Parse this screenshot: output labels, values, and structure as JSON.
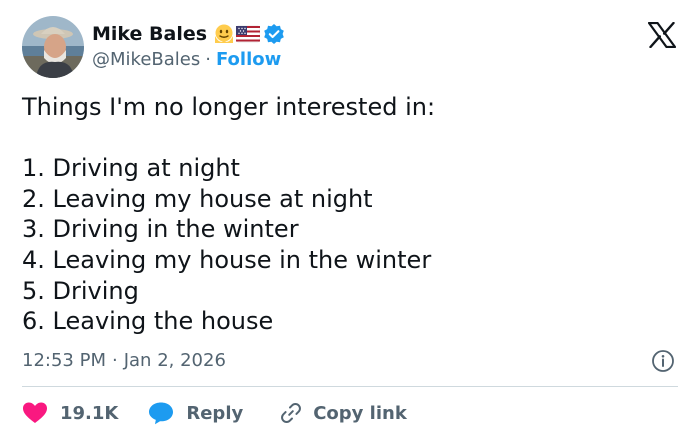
{
  "author": {
    "display_name": "Mike Bales",
    "handle": "@MikeBales",
    "separator": "·",
    "follow_label": "Follow",
    "badges": [
      "melting-face-emoji",
      "us-flag-emoji",
      "verified-badge"
    ]
  },
  "tweet": {
    "intro": "Things I'm no longer interested in:",
    "items": [
      "1. Driving at night",
      "2. Leaving my house at night",
      "3. Driving in the winter",
      "4. Leaving my house in the winter",
      "5. Driving",
      "6. Leaving the house"
    ]
  },
  "meta": {
    "time": "12:53 PM",
    "separator": "·",
    "date": "Jan 2, 2026"
  },
  "actions": {
    "like_count": "19.1K",
    "reply_label": "Reply",
    "copy_link_label": "Copy link"
  },
  "colors": {
    "text": "#0f1419",
    "secondary": "#536471",
    "accent": "#1d9bf0",
    "like": "#f91880",
    "divider": "#cfd9de"
  }
}
